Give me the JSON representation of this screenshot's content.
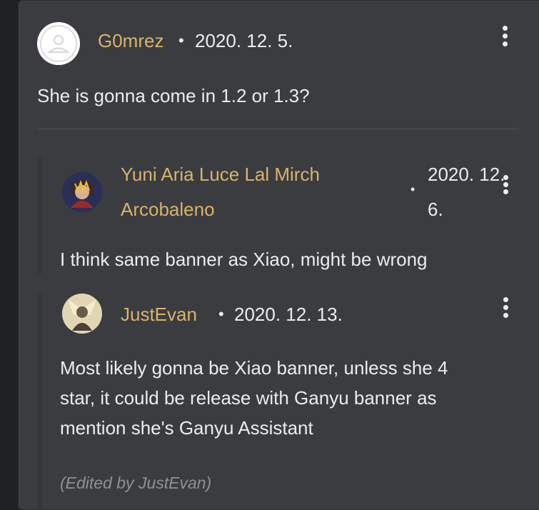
{
  "comment": {
    "author": "G0mrez",
    "dot": "•",
    "date": "2020. 12. 5.",
    "body": "She is gonna come in 1.2 or 1.3?",
    "avatar_icon": "default-user-avatar-icon",
    "menu_icon": "more-vertical-icon"
  },
  "replies": [
    {
      "author_line1": "Yuni Aria Luce Lal Mirch",
      "author_line2": "Arcobaleno",
      "dot": "•",
      "date_line1": "2020. 12.",
      "date_line2": "6.",
      "body": "I think same banner as Xiao, might be wrong",
      "avatar_icon": "character-avatar-icon",
      "menu_icon": "more-vertical-icon"
    },
    {
      "author": "JustEvan",
      "dot": "•",
      "date": "2020. 12. 13.",
      "body_line1": "Most likely gonna be Xiao banner, unless she 4",
      "body_line2": "star, it could be release with Ganyu banner as",
      "body_line3": "mention she's Ganyu Assistant",
      "edited": "(Edited by JustEvan)",
      "avatar_icon": "character-avatar-icon",
      "menu_icon": "more-vertical-icon"
    }
  ],
  "colors": {
    "background": "#1f2124",
    "card": "#3a3c40",
    "author": "#d9b36a",
    "text": "#ececec",
    "muted": "#8e9094"
  }
}
